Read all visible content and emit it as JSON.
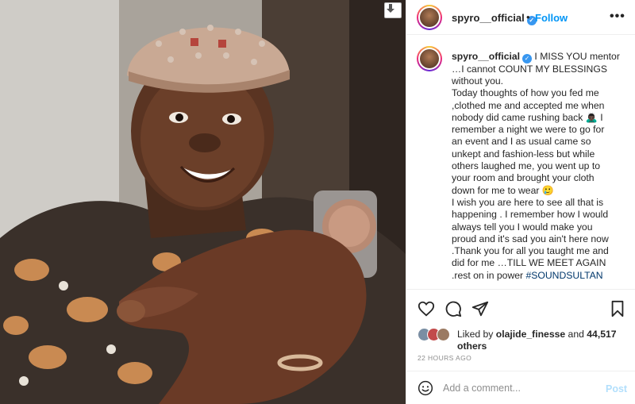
{
  "photo": {
    "alt_subject": "portrait-photo",
    "download_icon": "download-icon"
  },
  "header": {
    "username": "spyro__official",
    "separator": "•",
    "follow_label": "Follow",
    "more_label": "•••",
    "verified_glyph": "✓"
  },
  "caption": {
    "username": "spyro__official",
    "lines": [
      "I MISS YOU mentor",
      "…I cannot COUNT MY BLESSINGS",
      "without you.",
      "Today thoughts of how you fed me",
      ",clothed me and accepted me when",
      "nobody did came rushing back 🙇🏿‍♂️ I",
      "remember a night we were to go for",
      "an event and I as usual came so",
      "unkept and fashion-less but while",
      "others laughed me, you went up to",
      "your room and brought your cloth",
      "down for me to wear 🥲",
      "I wish you are here to see all that is",
      "happening . I remember how I would",
      "always tell you I would make you",
      "proud and it's sad you ain't here now",
      ".Thank you for all you taught me and",
      "did for me …TILL WE MEET AGAIN",
      ".rest on in power "
    ],
    "hashtag": "#SOUNDSULTAN"
  },
  "actions": {
    "like_icon": "heart-icon",
    "comment_icon": "comment-icon",
    "share_icon": "share-icon",
    "save_icon": "bookmark-icon"
  },
  "likes": {
    "prefix": "Liked by ",
    "liker": "olajide_finesse",
    "middle": " and ",
    "count": "44,517",
    "suffix": "others"
  },
  "timestamp": "22 HOURS AGO",
  "comment": {
    "placeholder": "Add a comment...",
    "value": "",
    "post_label": "Post"
  },
  "colors": {
    "accent": "#0095f6",
    "verified": "#3897f0",
    "post_disabled": "#b2dffc",
    "hashtag": "#00376b",
    "muted": "#8e8e8e"
  }
}
